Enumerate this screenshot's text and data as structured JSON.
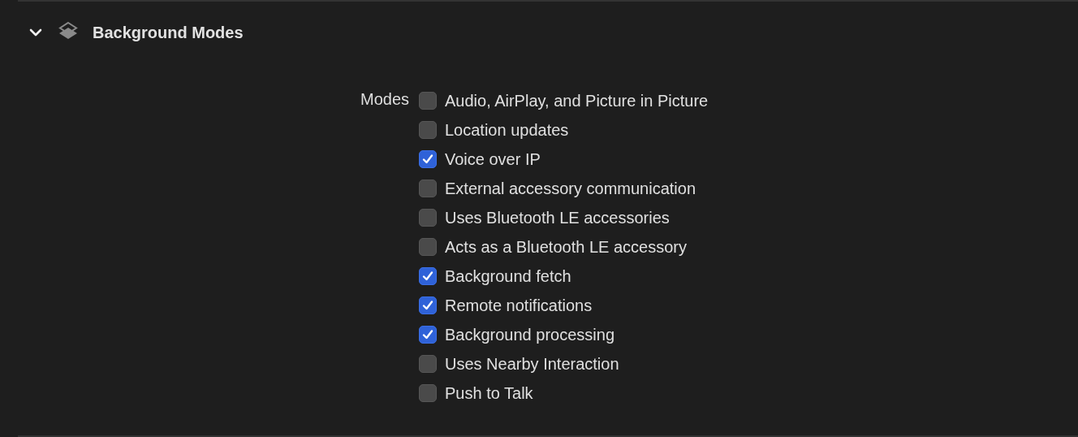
{
  "section": {
    "title": "Background Modes",
    "expanded": true
  },
  "modes_label": "Modes",
  "modes": [
    {
      "label": "Audio, AirPlay, and Picture in Picture",
      "checked": false
    },
    {
      "label": "Location updates",
      "checked": false
    },
    {
      "label": "Voice over IP",
      "checked": true
    },
    {
      "label": "External accessory communication",
      "checked": false
    },
    {
      "label": "Uses Bluetooth LE accessories",
      "checked": false
    },
    {
      "label": "Acts as a Bluetooth LE accessory",
      "checked": false
    },
    {
      "label": "Background fetch",
      "checked": true
    },
    {
      "label": "Remote notifications",
      "checked": true
    },
    {
      "label": "Background processing",
      "checked": true
    },
    {
      "label": "Uses Nearby Interaction",
      "checked": false
    },
    {
      "label": "Push to Talk",
      "checked": false
    }
  ]
}
